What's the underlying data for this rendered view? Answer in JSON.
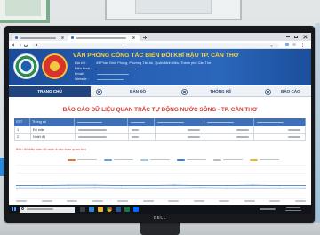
{
  "header": {
    "title": "VĂN PHÒNG CÔNG TÁC BIẾN ĐỔI KHÍ HẬU TP. CẦN THƠ",
    "info": [
      {
        "label": "Địa chỉ :",
        "value": "49 Phan Đình Phùng, Phường Tân An, Quận Ninh Kiều, Thành phố Cần Thơ"
      },
      {
        "label": "Điện thoại :"
      },
      {
        "label": "Email :"
      },
      {
        "label": "Website :"
      }
    ]
  },
  "nav": [
    {
      "label": "TRANG CHỦ",
      "active": true
    },
    {
      "label": "BẢN ĐỒ",
      "icon": "map-icon"
    },
    {
      "label": "THỐNG KÊ",
      "icon": "stats-icon"
    },
    {
      "label": "BÁO CÁO",
      "icon": "report-icon"
    }
  ],
  "report": {
    "title": "BÁO CÁO DỮ LIỆU QUAN TRẮC TỰ ĐỘNG NƯỚC SÔNG - TP. CẦN THƠ",
    "table": {
      "headers": [
        "STT",
        "Thông số"
      ],
      "rows": [
        {
          "stt": "1",
          "param": "Độ mặn"
        },
        {
          "stt": "2",
          "param": "Nhiệt độ"
        }
      ]
    }
  },
  "chart": {
    "label": "Biểu đồ diễn biến độ mặn ở các trạm quan trắc"
  },
  "chart_data": {
    "type": "line",
    "series": [
      {
        "color": "#3b82d6",
        "values": [
          0.38,
          0.38,
          0.39,
          0.39,
          0.38,
          0.38,
          0.39,
          0.38,
          0.38,
          0.39,
          0.38,
          0.38
        ]
      },
      {
        "color": "#b8bcc2",
        "values": [
          0.31,
          0.31,
          0.31,
          0.32,
          0.31,
          0.31,
          0.31,
          0.32,
          0.31,
          0.31,
          0.31,
          0.31
        ]
      }
    ],
    "legend_colors": [
      "#e8742c",
      "#5aa0e6",
      "#8fd0e8",
      "#3b82d6",
      "#b9bcc0",
      "#e8b832"
    ],
    "grid": true,
    "legend_position": "top"
  },
  "monitor": {
    "brand": "DELL"
  },
  "colors": {
    "banner": "#2862b6",
    "banner_title": "#f6d44a",
    "nav_active": "#21467f",
    "report_title": "#d43a2f",
    "table_header": "#3f70b5",
    "taskbar": "#101317"
  }
}
